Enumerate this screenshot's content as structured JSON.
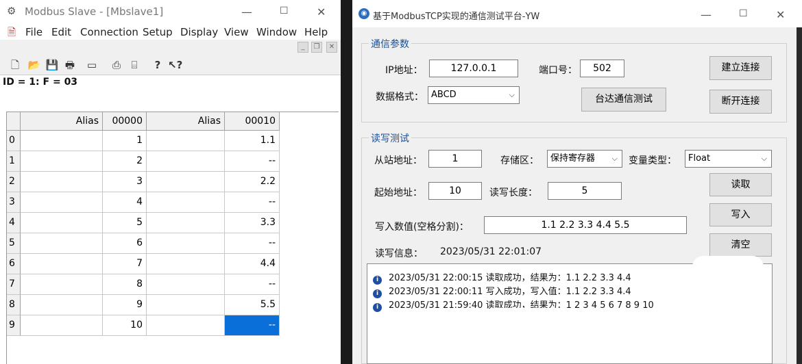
{
  "left_window": {
    "title": "Modbus Slave - [Mbslave1]",
    "menu": [
      "File",
      "Edit",
      "Connection",
      "Setup",
      "Display",
      "View",
      "Window",
      "Help"
    ],
    "id_line": "ID = 1: F = 03",
    "columns": [
      "Alias",
      "00000",
      "Alias",
      "00010"
    ],
    "rows": [
      {
        "n": "0",
        "a": "1",
        "b": "1.1"
      },
      {
        "n": "1",
        "a": "2",
        "b": "--"
      },
      {
        "n": "2",
        "a": "3",
        "b": "2.2"
      },
      {
        "n": "3",
        "a": "4",
        "b": "--"
      },
      {
        "n": "4",
        "a": "5",
        "b": "3.3"
      },
      {
        "n": "5",
        "a": "6",
        "b": "--"
      },
      {
        "n": "6",
        "a": "7",
        "b": "4.4"
      },
      {
        "n": "7",
        "a": "8",
        "b": "--"
      },
      {
        "n": "8",
        "a": "9",
        "b": "5.5"
      },
      {
        "n": "9",
        "a": "10",
        "b": "--"
      }
    ]
  },
  "right_window": {
    "title": "基于ModbusTCP实现的通信测试平台-YW",
    "comm_group": {
      "label": "通信参数",
      "ip_label": "IP地址：",
      "ip_value": "127.0.0.1",
      "port_label": "端口号：",
      "port_value": "502",
      "format_label": "数据格式：",
      "format_value": "ABCD",
      "delta_test_button": "台达通信测试",
      "connect_button": "建立连接",
      "disconnect_button": "断开连接"
    },
    "rw_group": {
      "label": "读写测试",
      "slave_label": "从站地址：",
      "slave_value": "1",
      "storage_label": "存储区：",
      "storage_value": "保持寄存器",
      "vartype_label": "变量类型：",
      "vartype_value": "Float",
      "start_label": "起始地址：",
      "start_value": "10",
      "length_label": "读写长度：",
      "length_value": "5",
      "write_label": "写入数值(空格分割)：",
      "write_value": "1.1 2.2 3.3 4.4 5.5",
      "info_label": "读写信息：",
      "info_value": "2023/05/31 22:01:07",
      "read_button": "读取",
      "write_button": "写入",
      "clear_button": "清空"
    },
    "log": [
      "2023/05/31 22:00:15   读取成功，结果为：1.1 2.2 3.3 4.4",
      "2023/05/31 22:00:11   写入成功，写入值：1.1 2.2 3.3 4.4",
      "2023/05/31 21:59:40   读取成功，结果为：1 2 3 4 5 6 7 8 9 10"
    ]
  }
}
